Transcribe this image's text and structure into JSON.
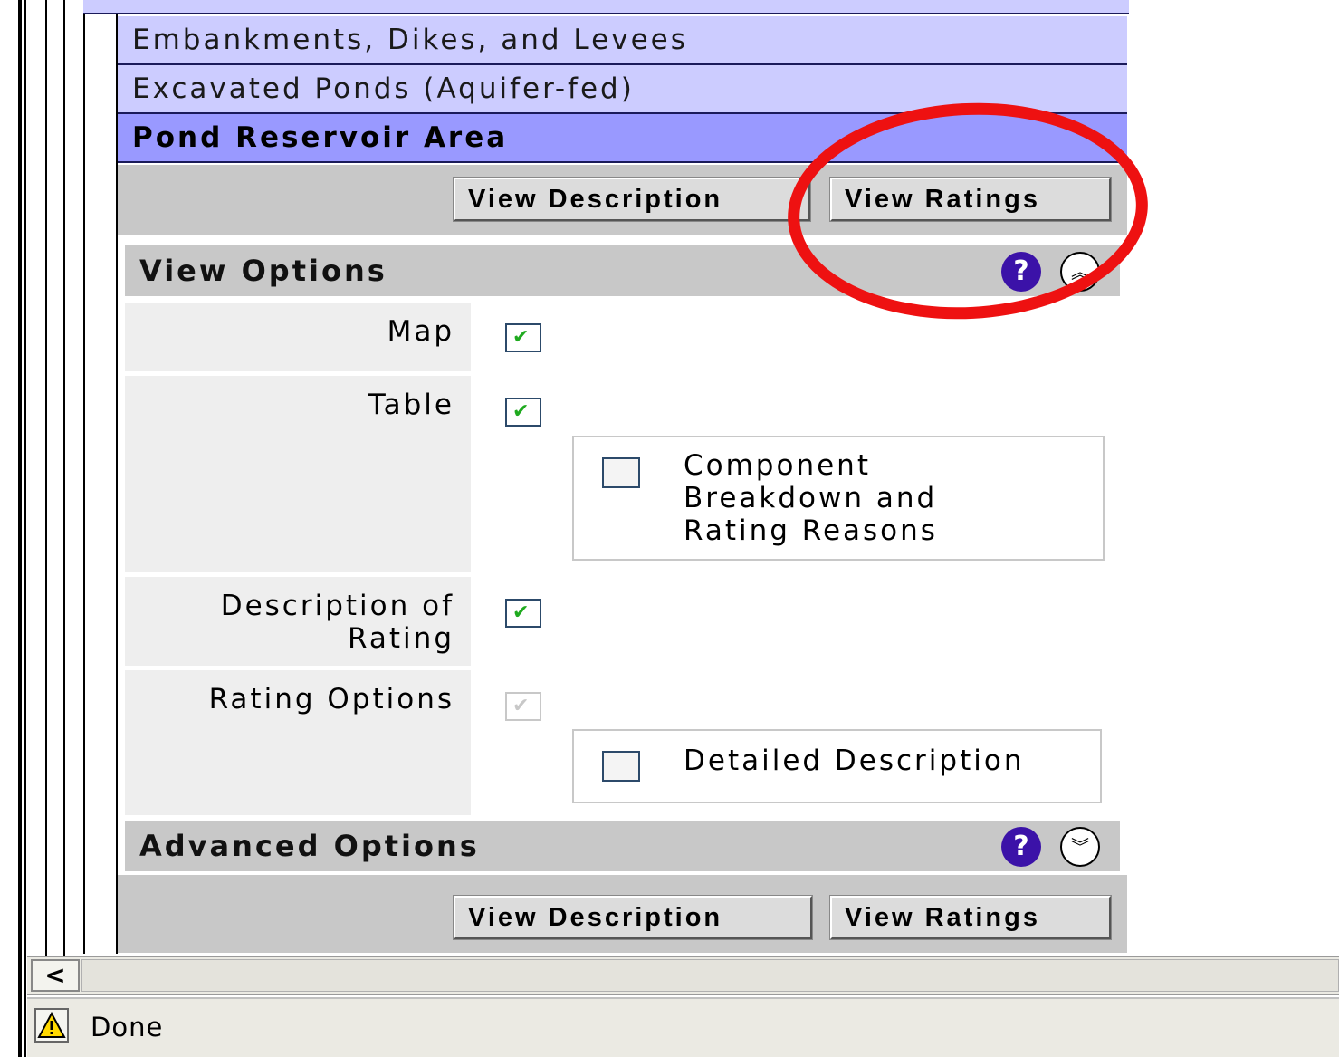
{
  "layer_list": {
    "items": [
      {
        "label": "Embankments, Dikes, and Levees",
        "active": false
      },
      {
        "label": "Excavated Ponds (Aquifer-fed)",
        "active": false
      },
      {
        "label": "Pond Reservoir Area",
        "active": true
      }
    ]
  },
  "top_buttons": {
    "view_description": "View Description",
    "view_ratings": "View Ratings"
  },
  "view_options": {
    "title": "View Options",
    "help_icon": "?",
    "toggle_icon": "collapse-up",
    "map_label": "Map",
    "map_checked": true,
    "table_label": "Table",
    "table_checked": true,
    "component_breakdown_label_1": "Component",
    "component_breakdown_label_2": "Breakdown and",
    "component_breakdown_label_3": "Rating Reasons",
    "component_breakdown_checked": false,
    "description_label_1": "Description of",
    "description_label_2": "Rating",
    "description_checked": true,
    "rating_options_label": "Rating Options",
    "rating_options_checked": true,
    "rating_options_disabled": true,
    "detailed_description_label": "Detailed Description",
    "detailed_description_checked": false
  },
  "advanced_options": {
    "title": "Advanced Options",
    "help_icon": "?",
    "toggle_icon": "expand-down"
  },
  "bottom_buttons": {
    "view_description": "View Description",
    "view_ratings": "View Ratings"
  },
  "status_bar": {
    "text": "Done",
    "icon": "warning-icon"
  },
  "scrollbar": {
    "left_arrow": "<"
  },
  "annotation": {
    "color": "#ee1111"
  }
}
